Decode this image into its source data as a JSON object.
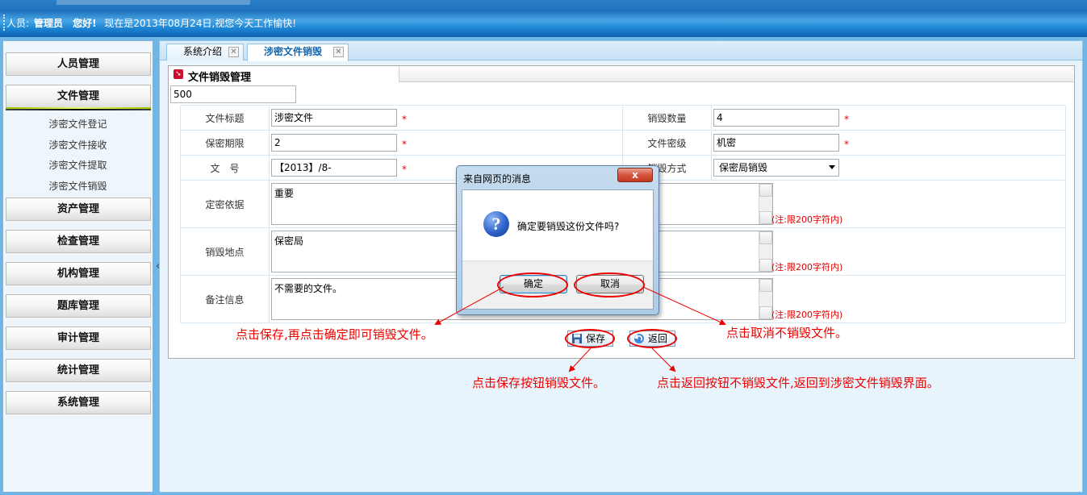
{
  "header": {
    "user_label": "人员:",
    "user_name": "管理员",
    "greeting": "您好!",
    "date_text": "现在是2013年08月24日,视您今天工作愉快!"
  },
  "sidebar": {
    "menus": [
      {
        "label": "人员管理"
      },
      {
        "label": "文件管理"
      },
      {
        "label": "资产管理"
      },
      {
        "label": "检查管理"
      },
      {
        "label": "机构管理"
      },
      {
        "label": "题库管理"
      },
      {
        "label": "审计管理"
      },
      {
        "label": "统计管理"
      },
      {
        "label": "系统管理"
      }
    ],
    "submenu": [
      {
        "label": "涉密文件登记"
      },
      {
        "label": "涉密文件接收"
      },
      {
        "label": "涉密文件提取"
      },
      {
        "label": "涉密文件销毁"
      }
    ],
    "collapse_glyph": "«"
  },
  "tabs": [
    {
      "label": "系统介绍"
    },
    {
      "label": "涉密文件销毁"
    }
  ],
  "panel": {
    "title": "文件销毁管理",
    "number_value": "500"
  },
  "form": {
    "title_label": "文件标题",
    "title_value": "涉密文件",
    "quantity_label": "销毁数量",
    "quantity_value": "4",
    "period_label": "保密期限",
    "period_value": "2",
    "level_label": "文件密级",
    "level_value": "机密",
    "docno_label": "文　号",
    "docno_value": "【2013】/8-",
    "method_label": "销毁方式",
    "method_value": "保密局销毁",
    "basis_label": "定密依据",
    "basis_value": "重要",
    "place_label": "销毁地点",
    "place_value": "保密局",
    "remark_label": "备注信息",
    "remark_value": "不需要的文件。",
    "limit_note": "(注:限200字符内)",
    "required_mark": "*"
  },
  "actions": {
    "save_label": "保存",
    "back_label": "返回"
  },
  "dialog": {
    "title": "来自网页的消息",
    "message": "确定要销毁这份文件吗?",
    "ok_label": "确定",
    "cancel_label": "取消",
    "close_glyph": "x",
    "icon_glyph": "?"
  },
  "annotations": {
    "confirm_note": "点击保存,再点击确定即可销毁文件。",
    "cancel_note": "点击取消不销毁文件。",
    "save_note": "点击保存按钮销毁文件。",
    "back_note": "点击返回按钮不销毁文件,返回到涉密文件销毁界面。",
    "color": "#e00000"
  }
}
